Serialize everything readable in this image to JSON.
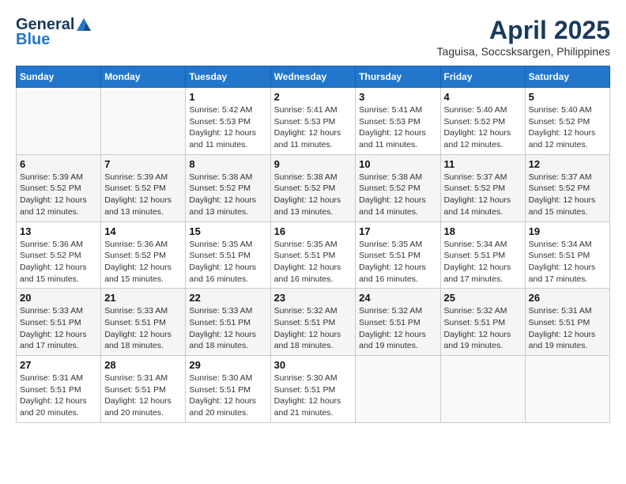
{
  "header": {
    "logo_general": "General",
    "logo_blue": "Blue",
    "month_year": "April 2025",
    "location": "Taguisa, Soccsksargen, Philippines"
  },
  "days_of_week": [
    "Sunday",
    "Monday",
    "Tuesday",
    "Wednesday",
    "Thursday",
    "Friday",
    "Saturday"
  ],
  "weeks": [
    [
      {
        "day": "",
        "sunrise": "",
        "sunset": "",
        "daylight": ""
      },
      {
        "day": "",
        "sunrise": "",
        "sunset": "",
        "daylight": ""
      },
      {
        "day": "1",
        "sunrise": "Sunrise: 5:42 AM",
        "sunset": "Sunset: 5:53 PM",
        "daylight": "Daylight: 12 hours and 11 minutes."
      },
      {
        "day": "2",
        "sunrise": "Sunrise: 5:41 AM",
        "sunset": "Sunset: 5:53 PM",
        "daylight": "Daylight: 12 hours and 11 minutes."
      },
      {
        "day": "3",
        "sunrise": "Sunrise: 5:41 AM",
        "sunset": "Sunset: 5:53 PM",
        "daylight": "Daylight: 12 hours and 11 minutes."
      },
      {
        "day": "4",
        "sunrise": "Sunrise: 5:40 AM",
        "sunset": "Sunset: 5:52 PM",
        "daylight": "Daylight: 12 hours and 12 minutes."
      },
      {
        "day": "5",
        "sunrise": "Sunrise: 5:40 AM",
        "sunset": "Sunset: 5:52 PM",
        "daylight": "Daylight: 12 hours and 12 minutes."
      }
    ],
    [
      {
        "day": "6",
        "sunrise": "Sunrise: 5:39 AM",
        "sunset": "Sunset: 5:52 PM",
        "daylight": "Daylight: 12 hours and 12 minutes."
      },
      {
        "day": "7",
        "sunrise": "Sunrise: 5:39 AM",
        "sunset": "Sunset: 5:52 PM",
        "daylight": "Daylight: 12 hours and 13 minutes."
      },
      {
        "day": "8",
        "sunrise": "Sunrise: 5:38 AM",
        "sunset": "Sunset: 5:52 PM",
        "daylight": "Daylight: 12 hours and 13 minutes."
      },
      {
        "day": "9",
        "sunrise": "Sunrise: 5:38 AM",
        "sunset": "Sunset: 5:52 PM",
        "daylight": "Daylight: 12 hours and 13 minutes."
      },
      {
        "day": "10",
        "sunrise": "Sunrise: 5:38 AM",
        "sunset": "Sunset: 5:52 PM",
        "daylight": "Daylight: 12 hours and 14 minutes."
      },
      {
        "day": "11",
        "sunrise": "Sunrise: 5:37 AM",
        "sunset": "Sunset: 5:52 PM",
        "daylight": "Daylight: 12 hours and 14 minutes."
      },
      {
        "day": "12",
        "sunrise": "Sunrise: 5:37 AM",
        "sunset": "Sunset: 5:52 PM",
        "daylight": "Daylight: 12 hours and 15 minutes."
      }
    ],
    [
      {
        "day": "13",
        "sunrise": "Sunrise: 5:36 AM",
        "sunset": "Sunset: 5:52 PM",
        "daylight": "Daylight: 12 hours and 15 minutes."
      },
      {
        "day": "14",
        "sunrise": "Sunrise: 5:36 AM",
        "sunset": "Sunset: 5:52 PM",
        "daylight": "Daylight: 12 hours and 15 minutes."
      },
      {
        "day": "15",
        "sunrise": "Sunrise: 5:35 AM",
        "sunset": "Sunset: 5:51 PM",
        "daylight": "Daylight: 12 hours and 16 minutes."
      },
      {
        "day": "16",
        "sunrise": "Sunrise: 5:35 AM",
        "sunset": "Sunset: 5:51 PM",
        "daylight": "Daylight: 12 hours and 16 minutes."
      },
      {
        "day": "17",
        "sunrise": "Sunrise: 5:35 AM",
        "sunset": "Sunset: 5:51 PM",
        "daylight": "Daylight: 12 hours and 16 minutes."
      },
      {
        "day": "18",
        "sunrise": "Sunrise: 5:34 AM",
        "sunset": "Sunset: 5:51 PM",
        "daylight": "Daylight: 12 hours and 17 minutes."
      },
      {
        "day": "19",
        "sunrise": "Sunrise: 5:34 AM",
        "sunset": "Sunset: 5:51 PM",
        "daylight": "Daylight: 12 hours and 17 minutes."
      }
    ],
    [
      {
        "day": "20",
        "sunrise": "Sunrise: 5:33 AM",
        "sunset": "Sunset: 5:51 PM",
        "daylight": "Daylight: 12 hours and 17 minutes."
      },
      {
        "day": "21",
        "sunrise": "Sunrise: 5:33 AM",
        "sunset": "Sunset: 5:51 PM",
        "daylight": "Daylight: 12 hours and 18 minutes."
      },
      {
        "day": "22",
        "sunrise": "Sunrise: 5:33 AM",
        "sunset": "Sunset: 5:51 PM",
        "daylight": "Daylight: 12 hours and 18 minutes."
      },
      {
        "day": "23",
        "sunrise": "Sunrise: 5:32 AM",
        "sunset": "Sunset: 5:51 PM",
        "daylight": "Daylight: 12 hours and 18 minutes."
      },
      {
        "day": "24",
        "sunrise": "Sunrise: 5:32 AM",
        "sunset": "Sunset: 5:51 PM",
        "daylight": "Daylight: 12 hours and 19 minutes."
      },
      {
        "day": "25",
        "sunrise": "Sunrise: 5:32 AM",
        "sunset": "Sunset: 5:51 PM",
        "daylight": "Daylight: 12 hours and 19 minutes."
      },
      {
        "day": "26",
        "sunrise": "Sunrise: 5:31 AM",
        "sunset": "Sunset: 5:51 PM",
        "daylight": "Daylight: 12 hours and 19 minutes."
      }
    ],
    [
      {
        "day": "27",
        "sunrise": "Sunrise: 5:31 AM",
        "sunset": "Sunset: 5:51 PM",
        "daylight": "Daylight: 12 hours and 20 minutes."
      },
      {
        "day": "28",
        "sunrise": "Sunrise: 5:31 AM",
        "sunset": "Sunset: 5:51 PM",
        "daylight": "Daylight: 12 hours and 20 minutes."
      },
      {
        "day": "29",
        "sunrise": "Sunrise: 5:30 AM",
        "sunset": "Sunset: 5:51 PM",
        "daylight": "Daylight: 12 hours and 20 minutes."
      },
      {
        "day": "30",
        "sunrise": "Sunrise: 5:30 AM",
        "sunset": "Sunset: 5:51 PM",
        "daylight": "Daylight: 12 hours and 21 minutes."
      },
      {
        "day": "",
        "sunrise": "",
        "sunset": "",
        "daylight": ""
      },
      {
        "day": "",
        "sunrise": "",
        "sunset": "",
        "daylight": ""
      },
      {
        "day": "",
        "sunrise": "",
        "sunset": "",
        "daylight": ""
      }
    ]
  ]
}
